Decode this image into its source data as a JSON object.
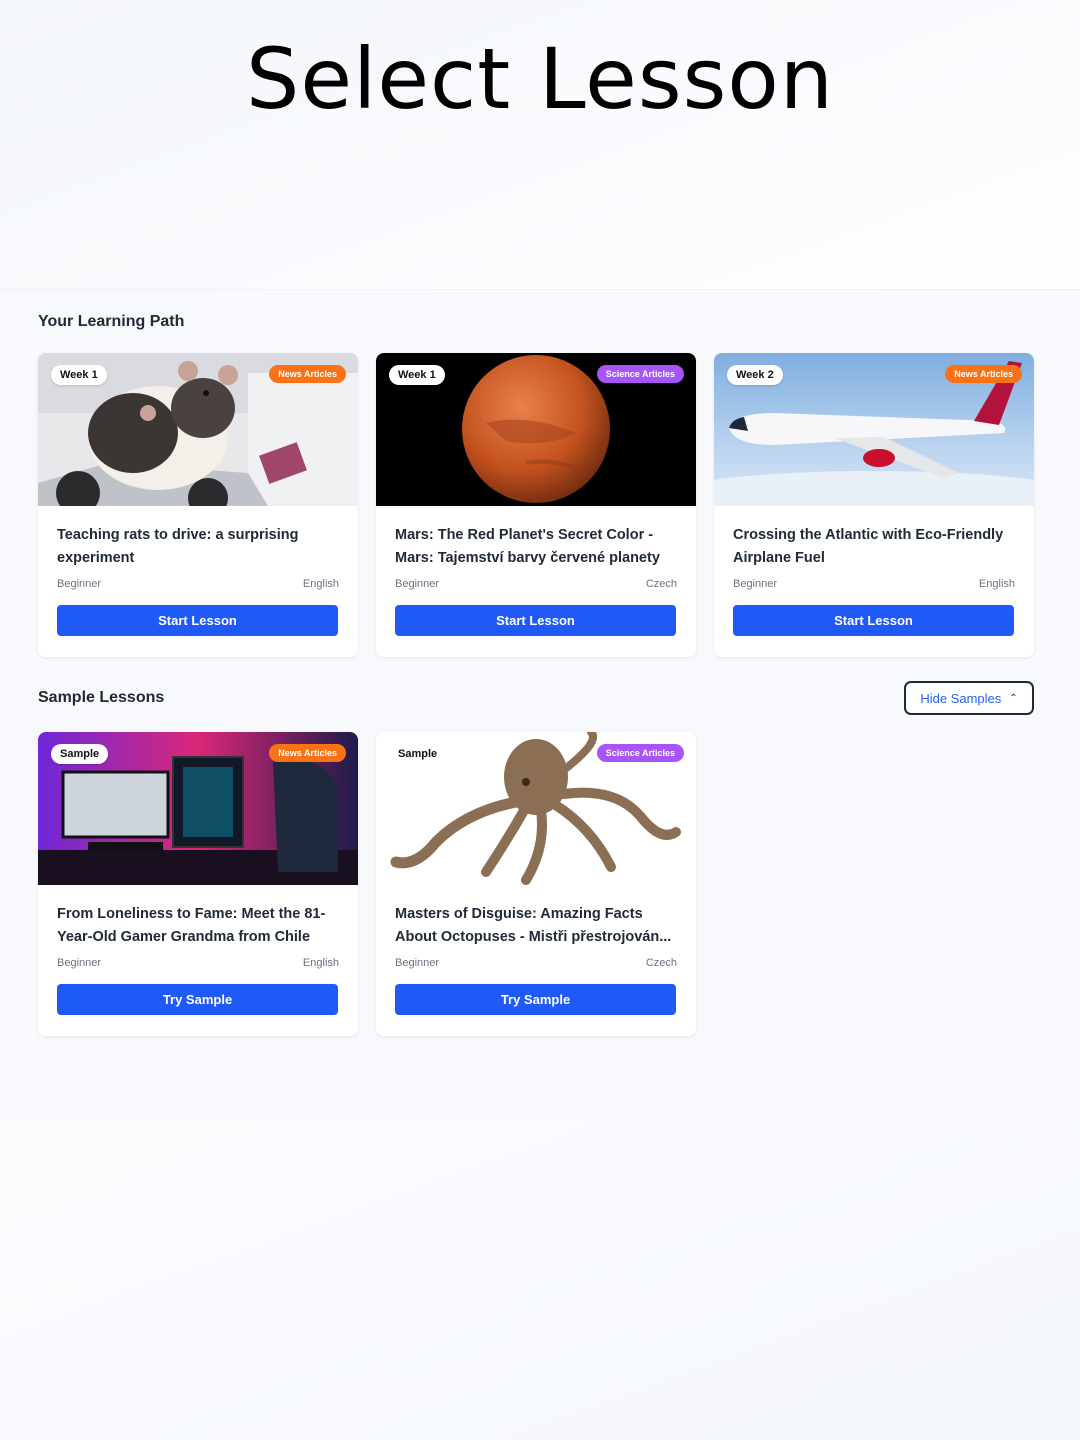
{
  "page": {
    "title": "Select Lesson"
  },
  "learning_path": {
    "title": "Your Learning Path",
    "cards": [
      {
        "badge": "Week 1",
        "category": "News Articles",
        "category_color": "#f97316",
        "image": "rat-robot-car-image",
        "title_line1": "Teaching rats to drive: a surprising",
        "title_line2": "experiment",
        "level": "Beginner",
        "language": "English",
        "button": "Start Lesson"
      },
      {
        "badge": "Week 1",
        "category": "Science Articles",
        "category_color": "#a855f7",
        "image": "mars-planet-image",
        "title_line1": "Mars: The Red Planet's Secret Color -",
        "title_line2": "Mars: Tajemství barvy červené planety",
        "level": "Beginner",
        "language": "Czech",
        "button": "Start Lesson"
      },
      {
        "badge": "Week 2",
        "category": "News Articles",
        "category_color": "#f97316",
        "image": "airplane-image",
        "title_line1": "Crossing the Atlantic with Eco-Friendly",
        "title_line2": "Airplane Fuel",
        "level": "Beginner",
        "language": "English",
        "button": "Start Lesson"
      }
    ]
  },
  "samples": {
    "title": "Sample Lessons",
    "toggle_label": "Hide Samples",
    "toggle_icon": "chevron-up-icon",
    "cards": [
      {
        "badge": "Sample",
        "category": "News Articles",
        "category_color": "#f97316",
        "image": "gaming-setup-image",
        "title_line1": "From Loneliness to Fame: Meet the 81-",
        "title_line2": "Year-Old Gamer Grandma from Chile",
        "level": "Beginner",
        "language": "English",
        "button": "Try Sample"
      },
      {
        "badge": "Sample",
        "category": "Science Articles",
        "category_color": "#a855f7",
        "image": "octopus-image",
        "title_line1": "Masters of Disguise: Amazing Facts",
        "title_line2": "About Octopuses - Mistři přestrojován...",
        "level": "Beginner",
        "language": "Czech",
        "button": "Try Sample"
      }
    ]
  },
  "colors": {
    "primary_button": "#1f5af6",
    "news_badge": "#f97316",
    "science_badge": "#a855f7"
  }
}
